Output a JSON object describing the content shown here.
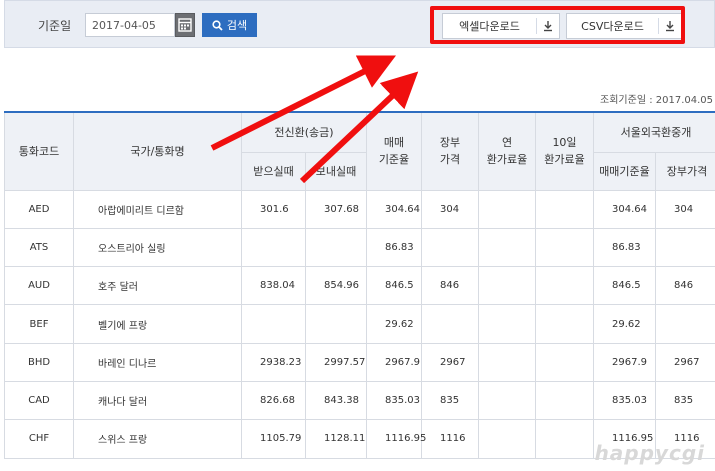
{
  "toolbar": {
    "date_label": "기준일",
    "date_value": "2017-04-05",
    "search_label": "검색",
    "excel_label": "엑셀다운로드",
    "csv_label": "CSV다운로드"
  },
  "view_date": "조회기준일 : 2017.04.05",
  "table": {
    "headers": {
      "code": "통화코드",
      "name": "국가/통화명",
      "tt_group": "전신환(송금)",
      "tt_receive": "받으실때",
      "tt_send": "보내실때",
      "base": "매매\n기준율",
      "book": "장부\n가격",
      "annual": "연\n환가료율",
      "ten_day": "10일\n환가료율",
      "seoul_group": "서울외국환중개",
      "seoul_base": "매매기준율",
      "seoul_book": "장부가격"
    },
    "rows": [
      {
        "code": "AED",
        "name": "아랍에미리트 디르함",
        "receive": "301.6",
        "send": "307.68",
        "base": "304.64",
        "book": "304",
        "annual": "",
        "ten": "",
        "s_base": "304.64",
        "s_book": "304"
      },
      {
        "code": "ATS",
        "name": "오스트리아 실링",
        "receive": "",
        "send": "",
        "base": "86.83",
        "book": "",
        "annual": "",
        "ten": "",
        "s_base": "86.83",
        "s_book": ""
      },
      {
        "code": "AUD",
        "name": "호주 달러",
        "receive": "838.04",
        "send": "854.96",
        "base": "846.5",
        "book": "846",
        "annual": "",
        "ten": "",
        "s_base": "846.5",
        "s_book": "846"
      },
      {
        "code": "BEF",
        "name": "벨기에 프랑",
        "receive": "",
        "send": "",
        "base": "29.62",
        "book": "",
        "annual": "",
        "ten": "",
        "s_base": "29.62",
        "s_book": ""
      },
      {
        "code": "BHD",
        "name": "바레인 디나르",
        "receive": "2938.23",
        "send": "2997.57",
        "base": "2967.9",
        "book": "2967",
        "annual": "",
        "ten": "",
        "s_base": "2967.9",
        "s_book": "2967"
      },
      {
        "code": "CAD",
        "name": "캐나다 달러",
        "receive": "826.68",
        "send": "843.38",
        "base": "835.03",
        "book": "835",
        "annual": "",
        "ten": "",
        "s_base": "835.03",
        "s_book": "835"
      },
      {
        "code": "CHF",
        "name": "스위스 프랑",
        "receive": "1105.79",
        "send": "1128.11",
        "base": "1116.95",
        "book": "1116",
        "annual": "",
        "ten": "",
        "s_base": "1116.95",
        "s_book": "1116"
      }
    ]
  },
  "annotation": {
    "color": "#f00f0f"
  },
  "watermark": "happycgi"
}
